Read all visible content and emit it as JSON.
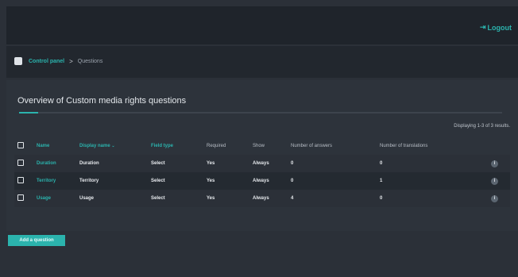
{
  "header": {
    "logout_label": "Logout",
    "logout_icon": "logout-arrow"
  },
  "breadcrumb": {
    "home_icon": "home-icon",
    "items": [
      "Control panel",
      "Questions"
    ],
    "separator": ">"
  },
  "main": {
    "title": "Overview of Custom media rights questions",
    "progress": 0.04,
    "results_text": "Displaying 1-3 of 3 results."
  },
  "table": {
    "columns": [
      "Name",
      "Display name",
      "Field type",
      "Required",
      "Show",
      "Number of answers",
      "Number of translations"
    ],
    "sort_indicator": "⌄",
    "rows": [
      {
        "name": "Duration",
        "display_name": "Duration",
        "field_type": "Select",
        "required": "Yes",
        "show": "Always",
        "answers": "0",
        "translations": "0"
      },
      {
        "name": "Territory",
        "display_name": "Territory",
        "field_type": "Select",
        "required": "Yes",
        "show": "Always",
        "answers": "0",
        "translations": "1"
      },
      {
        "name": "Usage",
        "display_name": "Usage",
        "field_type": "Select",
        "required": "Yes",
        "show": "Always",
        "answers": "4",
        "translations": "0"
      }
    ]
  },
  "actions": {
    "add_question_label": "Add a question"
  },
  "colors": {
    "accent": "#2bb3ad",
    "background": "#2b3038"
  }
}
